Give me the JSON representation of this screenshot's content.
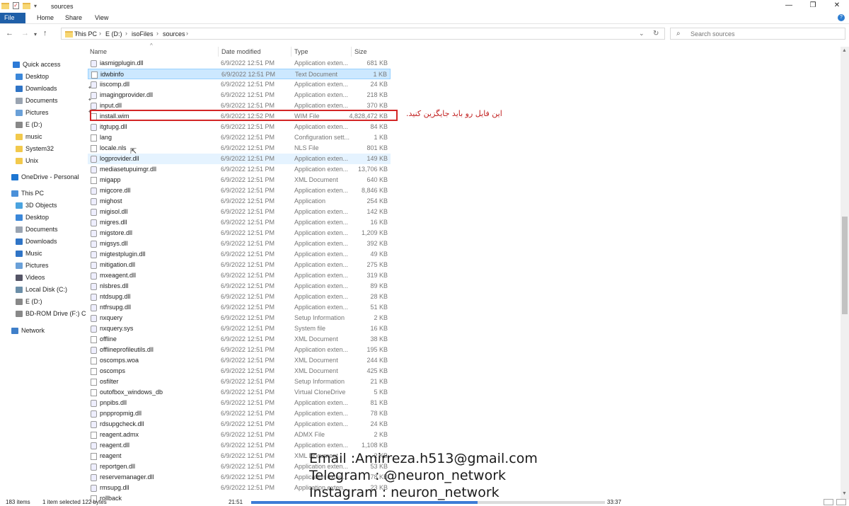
{
  "window": {
    "title": "sources",
    "controls": {
      "minimize": "—",
      "maximize": "❐",
      "close": "✕"
    }
  },
  "ribbon": {
    "tabs": [
      "File",
      "Home",
      "Share",
      "View"
    ]
  },
  "address": {
    "segments": [
      "This PC",
      "E (D:)",
      "isoFiles",
      "sources"
    ]
  },
  "search": {
    "placeholder": "Search sources"
  },
  "sidebar": {
    "items": [
      {
        "label": "Quick access",
        "icon": "star-icon",
        "color": "#2d7ad6"
      },
      {
        "label": "Desktop",
        "icon": "desktop-icon",
        "color": "#3b87d9",
        "pinned": true
      },
      {
        "label": "Downloads",
        "icon": "download-icon",
        "color": "#2f74c6",
        "pinned": true
      },
      {
        "label": "Documents",
        "icon": "documents-icon",
        "color": "#9aa4b1",
        "pinned": true
      },
      {
        "label": "Pictures",
        "icon": "pictures-icon",
        "color": "#6aa0d8",
        "pinned": true
      },
      {
        "label": "E (D:)",
        "icon": "drive-icon",
        "color": "#888"
      },
      {
        "label": "music",
        "icon": "folder-icon",
        "color": "#f2c94c"
      },
      {
        "label": "System32",
        "icon": "folder-icon",
        "color": "#f2c94c"
      },
      {
        "label": "Unix",
        "icon": "folder-icon",
        "color": "#f2c94c"
      },
      {
        "label": "OneDrive - Personal",
        "icon": "cloud-icon",
        "color": "#1d76d2"
      },
      {
        "label": "This PC",
        "icon": "computer-icon",
        "color": "#4a90d9"
      },
      {
        "label": "3D Objects",
        "icon": "cube-icon",
        "color": "#4aa3df"
      },
      {
        "label": "Desktop",
        "icon": "desktop-icon",
        "color": "#3b87d9"
      },
      {
        "label": "Documents",
        "icon": "documents-icon",
        "color": "#9aa4b1"
      },
      {
        "label": "Downloads",
        "icon": "download-icon",
        "color": "#2f74c6"
      },
      {
        "label": "Music",
        "icon": "music-icon",
        "color": "#2f74c6"
      },
      {
        "label": "Pictures",
        "icon": "pictures-icon",
        "color": "#6aa0d8"
      },
      {
        "label": "Videos",
        "icon": "videos-icon",
        "color": "#556"
      },
      {
        "label": "Local Disk (C:)",
        "icon": "disk-icon",
        "color": "#6b8ea8"
      },
      {
        "label": "E (D:)",
        "icon": "drive-icon",
        "color": "#888"
      },
      {
        "label": "BD-ROM Drive (F:) C",
        "icon": "disc-icon",
        "color": "#888"
      },
      {
        "label": "Network",
        "icon": "network-icon",
        "color": "#3f7fc9"
      }
    ]
  },
  "columns": {
    "name": "Name",
    "date": "Date modified",
    "type": "Type",
    "size": "Size"
  },
  "files": [
    {
      "name": "iasmigplugin.dll",
      "date": "6/9/2022 12:51 PM",
      "type": "Application exten...",
      "size": "681 KB"
    },
    {
      "name": "idwbinfo",
      "date": "6/9/2022 12:51 PM",
      "type": "Text Document",
      "size": "1 KB",
      "selected": true
    },
    {
      "name": "iiscomp.dll",
      "date": "6/9/2022 12:51 PM",
      "type": "Application exten...",
      "size": "24 KB"
    },
    {
      "name": "imagingprovider.dll",
      "date": "6/9/2022 12:51 PM",
      "type": "Application exten...",
      "size": "218 KB"
    },
    {
      "name": "input.dll",
      "date": "6/9/2022 12:51 PM",
      "type": "Application exten...",
      "size": "370 KB"
    },
    {
      "name": "install.wim",
      "date": "6/9/2022 12:52 PM",
      "type": "WIM File",
      "size": "4,828,472 KB",
      "highlighted": true
    },
    {
      "name": "itgtupg.dll",
      "date": "6/9/2022 12:51 PM",
      "type": "Application exten...",
      "size": "84 KB"
    },
    {
      "name": "lang",
      "date": "6/9/2022 12:51 PM",
      "type": "Configuration sett...",
      "size": "1 KB"
    },
    {
      "name": "locale.nls",
      "date": "6/9/2022 12:51 PM",
      "type": "NLS File",
      "size": "801 KB"
    },
    {
      "name": "logprovider.dll",
      "date": "6/9/2022 12:51 PM",
      "type": "Application exten...",
      "size": "149 KB",
      "hover": true
    },
    {
      "name": "mediasetupuimgr.dll",
      "date": "6/9/2022 12:51 PM",
      "type": "Application exten...",
      "size": "13,706 KB"
    },
    {
      "name": "migapp",
      "date": "6/9/2022 12:51 PM",
      "type": "XML Document",
      "size": "640 KB"
    },
    {
      "name": "migcore.dll",
      "date": "6/9/2022 12:51 PM",
      "type": "Application exten...",
      "size": "8,846 KB"
    },
    {
      "name": "mighost",
      "date": "6/9/2022 12:51 PM",
      "type": "Application",
      "size": "254 KB"
    },
    {
      "name": "migisol.dll",
      "date": "6/9/2022 12:51 PM",
      "type": "Application exten...",
      "size": "142 KB"
    },
    {
      "name": "migres.dll",
      "date": "6/9/2022 12:51 PM",
      "type": "Application exten...",
      "size": "16 KB"
    },
    {
      "name": "migstore.dll",
      "date": "6/9/2022 12:51 PM",
      "type": "Application exten...",
      "size": "1,209 KB"
    },
    {
      "name": "migsys.dll",
      "date": "6/9/2022 12:51 PM",
      "type": "Application exten...",
      "size": "392 KB"
    },
    {
      "name": "migtestplugin.dll",
      "date": "6/9/2022 12:51 PM",
      "type": "Application exten...",
      "size": "49 KB"
    },
    {
      "name": "mitigation.dll",
      "date": "6/9/2022 12:51 PM",
      "type": "Application exten...",
      "size": "275 KB"
    },
    {
      "name": "mxeagent.dll",
      "date": "6/9/2022 12:51 PM",
      "type": "Application exten...",
      "size": "319 KB"
    },
    {
      "name": "nlsbres.dll",
      "date": "6/9/2022 12:51 PM",
      "type": "Application exten...",
      "size": "89 KB"
    },
    {
      "name": "ntdsupg.dll",
      "date": "6/9/2022 12:51 PM",
      "type": "Application exten...",
      "size": "28 KB"
    },
    {
      "name": "ntfrsupg.dll",
      "date": "6/9/2022 12:51 PM",
      "type": "Application exten...",
      "size": "51 KB"
    },
    {
      "name": "nxquery",
      "date": "6/9/2022 12:51 PM",
      "type": "Setup Information",
      "size": "2 KB"
    },
    {
      "name": "nxquery.sys",
      "date": "6/9/2022 12:51 PM",
      "type": "System file",
      "size": "16 KB"
    },
    {
      "name": "offline",
      "date": "6/9/2022 12:51 PM",
      "type": "XML Document",
      "size": "38 KB"
    },
    {
      "name": "offlineprofileutils.dll",
      "date": "6/9/2022 12:51 PM",
      "type": "Application exten...",
      "size": "195 KB"
    },
    {
      "name": "oscomps.woa",
      "date": "6/9/2022 12:51 PM",
      "type": "XML Document",
      "size": "244 KB"
    },
    {
      "name": "oscomps",
      "date": "6/9/2022 12:51 PM",
      "type": "XML Document",
      "size": "425 KB"
    },
    {
      "name": "osfilter",
      "date": "6/9/2022 12:51 PM",
      "type": "Setup Information",
      "size": "21 KB"
    },
    {
      "name": "outofbox_windows_db",
      "date": "6/9/2022 12:51 PM",
      "type": "Virtual CloneDrive",
      "size": "5 KB"
    },
    {
      "name": "pnpibs.dll",
      "date": "6/9/2022 12:51 PM",
      "type": "Application exten...",
      "size": "81 KB"
    },
    {
      "name": "pnppropmig.dll",
      "date": "6/9/2022 12:51 PM",
      "type": "Application exten...",
      "size": "78 KB"
    },
    {
      "name": "rdsupgcheck.dll",
      "date": "6/9/2022 12:51 PM",
      "type": "Application exten...",
      "size": "24 KB"
    },
    {
      "name": "reagent.admx",
      "date": "6/9/2022 12:51 PM",
      "type": "ADMX File",
      "size": "2 KB"
    },
    {
      "name": "reagent.dll",
      "date": "6/9/2022 12:51 PM",
      "type": "Application exten...",
      "size": "1,108 KB"
    },
    {
      "name": "reagent",
      "date": "6/9/2022 12:51 PM",
      "type": "XML Document",
      "size": "2 KB"
    },
    {
      "name": "reportgen.dll",
      "date": "6/9/2022 12:51 PM",
      "type": "Application exten...",
      "size": "53 KB"
    },
    {
      "name": "reservemanager.dll",
      "date": "6/9/2022 12:51 PM",
      "type": "Application exten...",
      "size": "78 KB"
    },
    {
      "name": "rmsupg.dll",
      "date": "6/9/2022 12:51 PM",
      "type": "Application exten...",
      "size": "23 KB"
    },
    {
      "name": "rollback",
      "date": "",
      "type": "",
      "size": ""
    }
  ],
  "annotation": {
    "text": "این فایل رو باید جایگزین کنید.",
    "color": "#c21f1f"
  },
  "watermark": {
    "email": "Email :Amirreza.h513@gmail.com",
    "telegram": "Telegram : @neuron_network",
    "instagram": "Instagram : neuron_network"
  },
  "status": {
    "items": "183 items",
    "selected": "1 item selected  122 bytes"
  },
  "playback": {
    "elapsed": "21:51",
    "total": "33:37",
    "progress": 0.64
  }
}
